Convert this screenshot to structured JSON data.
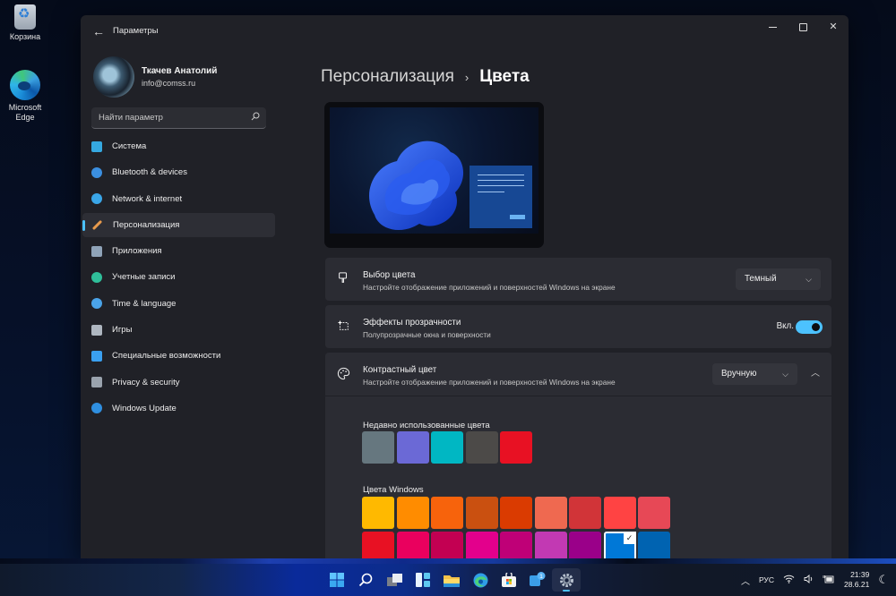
{
  "desktop": {
    "icons": [
      {
        "label": "Корзина",
        "icon": "recycle-bin-icon"
      },
      {
        "label": "Microsoft Edge",
        "icon": "edge-icon"
      }
    ]
  },
  "window": {
    "title": "Параметры",
    "controls": {
      "minimize": "minimize",
      "maximize": "maximize",
      "close": "✕"
    }
  },
  "profile": {
    "name": "Ткачев Анатолий",
    "email": "info@comss.ru"
  },
  "search": {
    "placeholder": "Найти параметр"
  },
  "sidebar": {
    "items": [
      {
        "label": "Система",
        "icon": "monitor-icon",
        "color": "#35a8e0"
      },
      {
        "label": "Bluetooth & devices",
        "icon": "bluetooth-icon",
        "color": "#3b8fe0"
      },
      {
        "label": "Network & internet",
        "icon": "wifi-icon",
        "color": "#3aa6e8"
      },
      {
        "label": "Персонализация",
        "icon": "brush-icon",
        "color": "#e89a4c",
        "active": true
      },
      {
        "label": "Приложения",
        "icon": "apps-icon",
        "color": "#8fa3b8"
      },
      {
        "label": "Учетные записи",
        "icon": "person-icon",
        "color": "#2fbf9a"
      },
      {
        "label": "Time & language",
        "icon": "clock-globe-icon",
        "color": "#4aa3e8"
      },
      {
        "label": "Игры",
        "icon": "gamepad-icon",
        "color": "#aeb6c0"
      },
      {
        "label": "Специальные возможности",
        "icon": "accessibility-icon",
        "color": "#3aa0f0"
      },
      {
        "label": "Privacy & security",
        "icon": "shield-icon",
        "color": "#9aa3ad"
      },
      {
        "label": "Windows Update",
        "icon": "update-icon",
        "color": "#2f8fe0"
      }
    ]
  },
  "breadcrumb": {
    "parent": "Персонализация",
    "separator": "›",
    "current": "Цвета"
  },
  "settings": {
    "color_mode": {
      "title": "Выбор цвета",
      "subtitle": "Настройте отображение приложений и поверхностей Windows на экране",
      "value": "Темный"
    },
    "transparency": {
      "title": "Эффекты прозрачности",
      "subtitle": "Полупрозрачные окна и поверхности",
      "state_label": "Вкл.",
      "enabled": true
    },
    "accent": {
      "title": "Контрастный цвет",
      "subtitle": "Настройте отображение приложений и поверхностей Windows на экране",
      "value": "Вручную",
      "expanded": true,
      "recent_label": "Недавно использованные цвета",
      "recent_colors": [
        "#66777f",
        "#6b69d6",
        "#00b7c3",
        "#4c4a48",
        "#e81123"
      ],
      "windows_label": "Цвета Windows",
      "windows_colors": [
        [
          "#ffb900",
          "#ff8c00",
          "#f7630c",
          "#ca5010",
          "#da3b01",
          "#ef6950",
          "#d13438",
          "#ff4343",
          "#e74856"
        ],
        [
          "#e81123",
          "#ea005e",
          "#c30052",
          "#e3008c",
          "#bf0077",
          "#c239b3",
          "#9a0089",
          "#0078d7",
          "#0063b1"
        ],
        [
          "#8e8cd8",
          "#6b69d6",
          "#8764b8",
          "#744da9",
          "#b146c2",
          "#881798",
          "#0099bc",
          "#2d7d9a",
          "#00b7c3"
        ]
      ],
      "selected": "#0078d7"
    }
  },
  "taskbar": {
    "apps": [
      {
        "name": "start",
        "icon": "windows-logo-icon"
      },
      {
        "name": "search",
        "icon": "search-icon"
      },
      {
        "name": "task-view",
        "icon": "task-view-icon"
      },
      {
        "name": "widgets",
        "icon": "widgets-icon"
      },
      {
        "name": "file-explorer",
        "icon": "folder-icon"
      },
      {
        "name": "edge",
        "icon": "edge-icon"
      },
      {
        "name": "store",
        "icon": "store-icon"
      },
      {
        "name": "teams",
        "icon": "chat-icon",
        "badge": "1"
      },
      {
        "name": "settings",
        "icon": "gear-icon",
        "active": true
      }
    ],
    "tray": {
      "language": "РУС",
      "time": "21:39",
      "date": "28.6.21"
    }
  }
}
